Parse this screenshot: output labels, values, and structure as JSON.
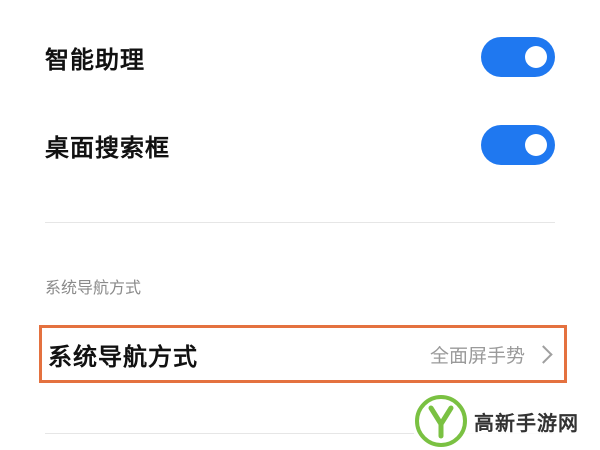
{
  "settings": {
    "smart_assistant": {
      "label": "智能助理",
      "enabled": true
    },
    "desktop_search": {
      "label": "桌面搜索框",
      "enabled": true
    }
  },
  "navigation_section": {
    "header": "系统导航方式",
    "item": {
      "label": "系统导航方式",
      "value": "全面屏手势"
    }
  },
  "watermark": {
    "text": "高新手游网"
  },
  "colors": {
    "toggle_on": "#1f78f0",
    "highlight_border": "#e4713f",
    "logo_green": "#7ac142"
  },
  "icons": {
    "chevron": "chevron-right-icon",
    "logo": "site-logo-icon"
  }
}
